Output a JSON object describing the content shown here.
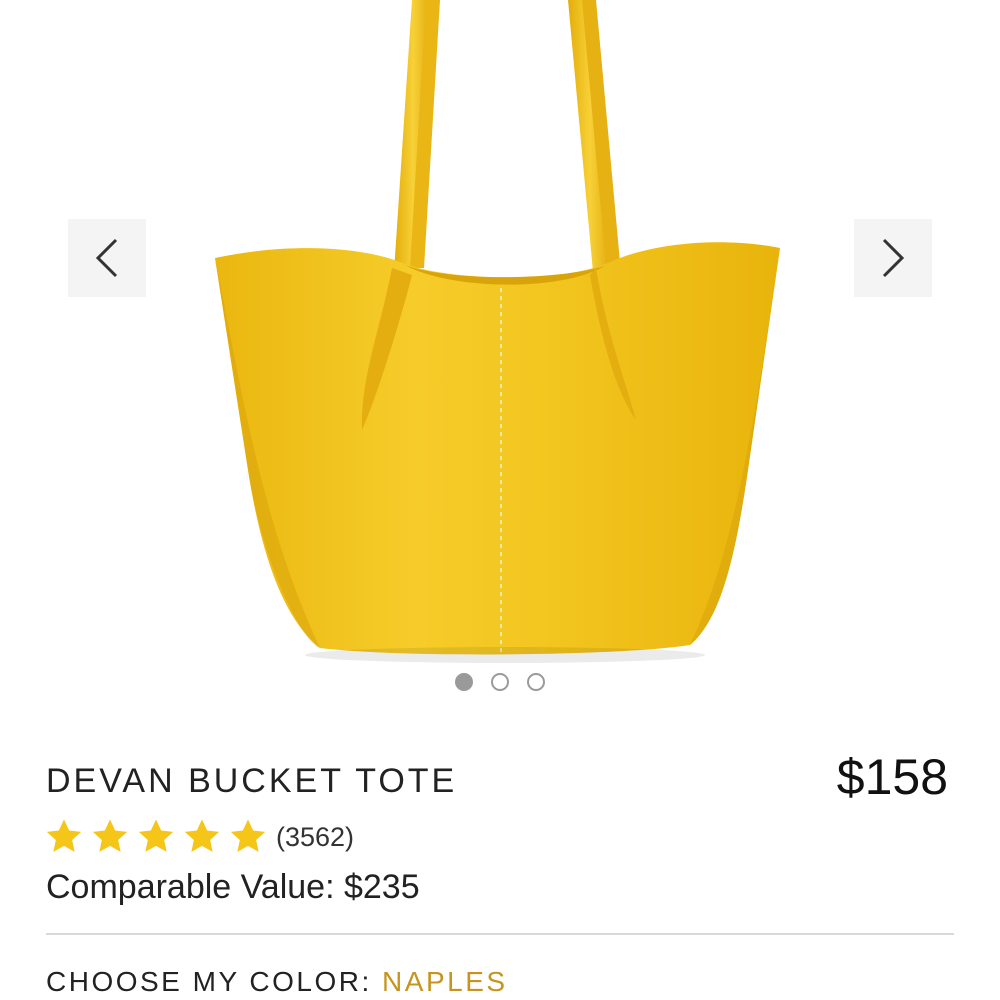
{
  "gallery": {
    "product_image": "yellow-leather-bucket-tote",
    "prev_icon": "chevron-left-icon",
    "next_icon": "chevron-right-icon",
    "slide_count": 3,
    "active_slide": 1,
    "bag_color": "#f2c31e",
    "arrow_bg": "#f4f4f4"
  },
  "product": {
    "title": "DEVAN BUCKET TOTE",
    "price": "$158",
    "rating": {
      "stars": 5,
      "max_stars": 5,
      "count": "(3562)",
      "star_color": "#f5c518",
      "star_icon": "star-icon"
    },
    "comparable_label": "Comparable Value: ",
    "comparable_value": "$235"
  },
  "color_selector": {
    "label": "CHOOSE MY COLOR: ",
    "value": "NAPLES",
    "value_color": "#c6951f"
  }
}
